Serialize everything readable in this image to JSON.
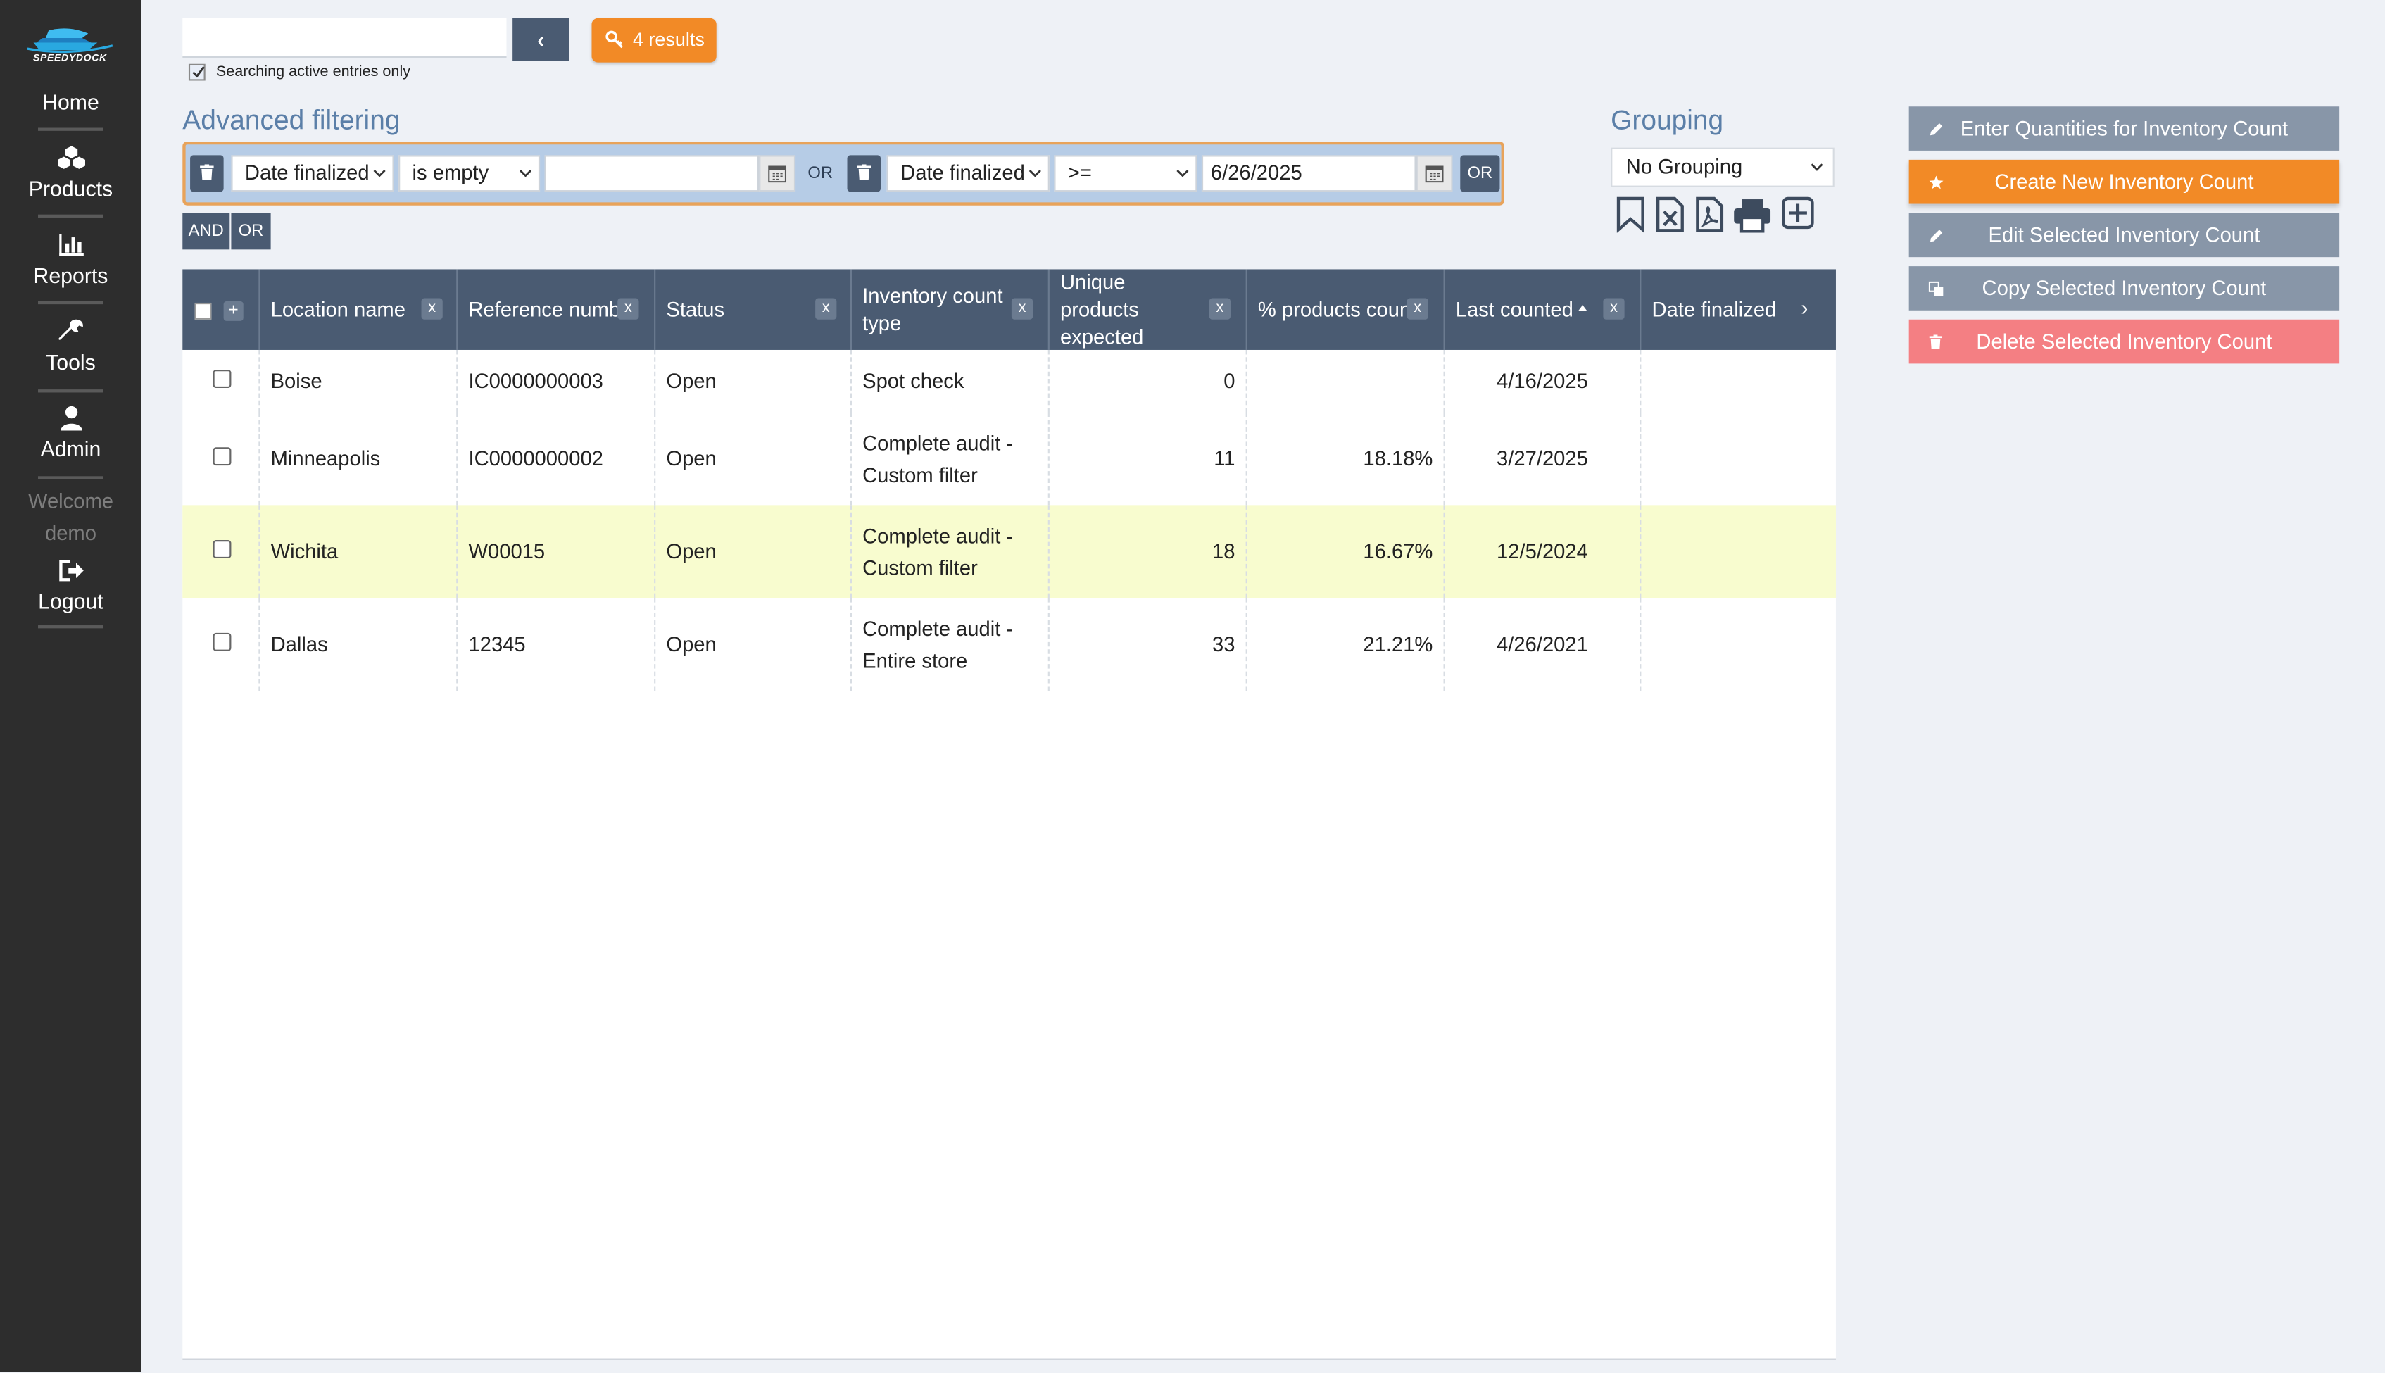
{
  "app": {
    "brand": "SPEEDYDOCK"
  },
  "sidebar": {
    "items": [
      {
        "label": "Home",
        "icon": "home"
      },
      {
        "label": "Products",
        "icon": "cubes-icon"
      },
      {
        "label": "Reports",
        "icon": "bar-chart-icon"
      },
      {
        "label": "Tools",
        "icon": "wrench-icon"
      },
      {
        "label": "Admin",
        "icon": "user-icon"
      }
    ],
    "welcome": "Welcome",
    "username": "demo",
    "logout": "Logout"
  },
  "search": {
    "value": "",
    "back_label": "‹",
    "results_label": "4 results",
    "active_only_label": "Searching active entries only",
    "active_only_checked": true
  },
  "advanced": {
    "title": "Advanced filtering",
    "filter1": {
      "field": "Date finalized",
      "operator": "is empty",
      "value": ""
    },
    "or_label": "OR",
    "filter2": {
      "field": "Date finalized",
      "operator": ">=",
      "value": "6/26/2025"
    },
    "or_button": "OR",
    "and_button": "AND",
    "or_button2": "OR"
  },
  "grouping": {
    "title": "Grouping",
    "selected": "No Grouping",
    "tools": [
      "bookmark-icon",
      "excel-export-icon",
      "pdf-export-icon",
      "print-icon",
      "add-icon"
    ]
  },
  "actions": [
    {
      "label": "Enter Quantities for Inventory Count",
      "style": "gray",
      "icon": "pencil-icon"
    },
    {
      "label": "Create New Inventory Count",
      "style": "orange",
      "icon": "star-icon"
    },
    {
      "label": "Edit Selected Inventory Count",
      "style": "gray",
      "icon": "pencil-icon"
    },
    {
      "label": "Copy Selected Inventory Count",
      "style": "gray",
      "icon": "copy-icon"
    },
    {
      "label": "Delete Selected Inventory Count",
      "style": "red",
      "icon": "trash-icon"
    }
  ],
  "table": {
    "plus": "+",
    "remove": "x",
    "columns": [
      {
        "label": "Location name"
      },
      {
        "label": "Reference number"
      },
      {
        "label": "Status"
      },
      {
        "label": "Inventory count type"
      },
      {
        "label": "Unique products expected"
      },
      {
        "label": "% products counted"
      },
      {
        "label": "Last counted",
        "sort": "asc"
      },
      {
        "label": "Date finalized"
      }
    ],
    "more": "›",
    "rows": [
      {
        "location": "Boise",
        "reference": "IC0000000003",
        "status": "Open",
        "type": "Spot check",
        "expected": "0",
        "pct": "",
        "last": "4/16/2025",
        "finalized": ""
      },
      {
        "location": "Minneapolis",
        "reference": "IC0000000002",
        "status": "Open",
        "type": "Complete audit - Custom filter",
        "expected": "11",
        "pct": "18.18%",
        "last": "3/27/2025",
        "finalized": ""
      },
      {
        "location": "Wichita",
        "reference": "W00015",
        "status": "Open",
        "type": "Complete audit - Custom filter",
        "expected": "18",
        "pct": "16.67%",
        "last": "12/5/2024",
        "finalized": ""
      },
      {
        "location": "Dallas",
        "reference": "12345",
        "status": "Open",
        "type": "Complete audit - Entire store",
        "expected": "33",
        "pct": "21.21%",
        "last": "4/26/2021",
        "finalized": ""
      }
    ]
  }
}
